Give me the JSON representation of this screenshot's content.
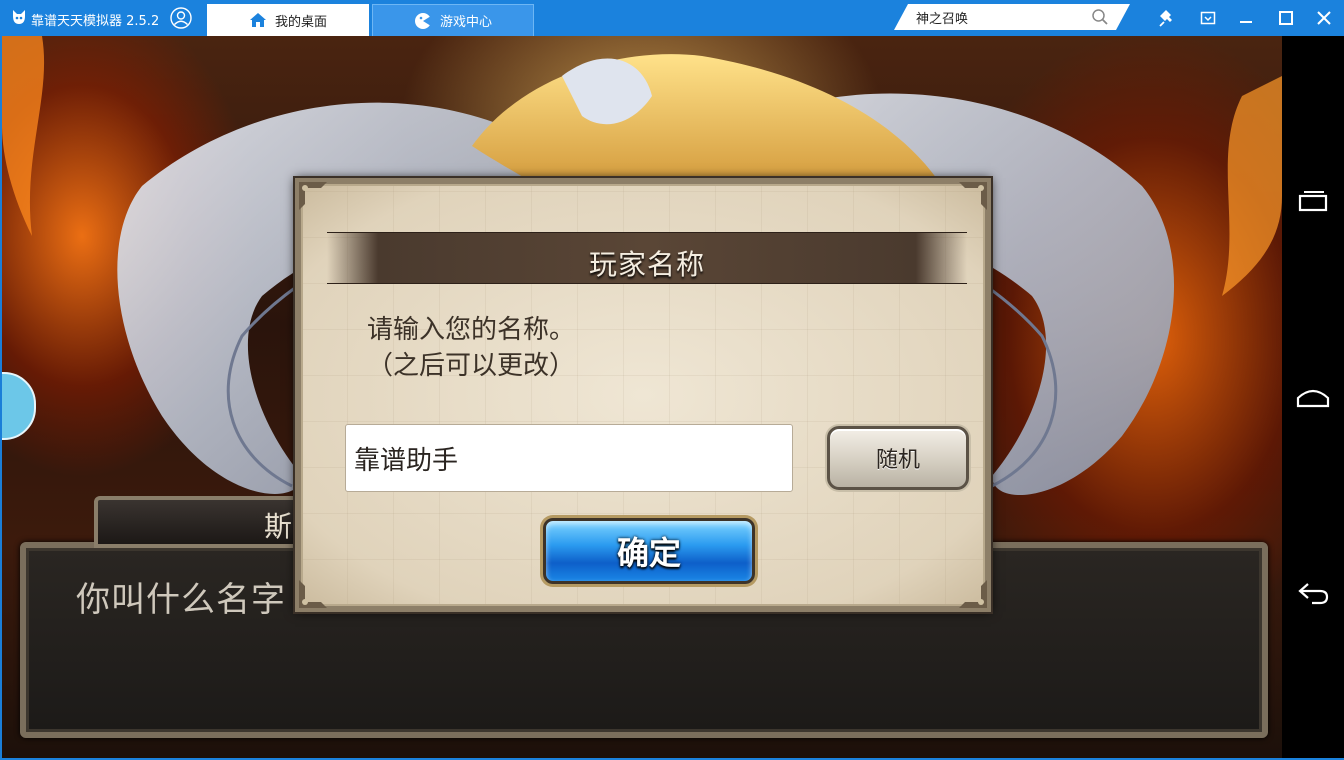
{
  "app": {
    "title": "靠谱天天模拟器 2.5.2"
  },
  "tabs": [
    {
      "label": "我的桌面",
      "icon": "home-icon",
      "active": true
    },
    {
      "label": "游戏中心",
      "icon": "gamepad-icon",
      "active": false
    }
  ],
  "search": {
    "value": "神之召唤"
  },
  "window_controls": [
    "pin-icon",
    "minimize-to-tray-icon",
    "minimize-icon",
    "maximize-icon",
    "close-icon"
  ],
  "android_nav": [
    "recent-apps-icon",
    "home-icon",
    "back-icon"
  ],
  "game": {
    "speaker_name": "斯",
    "speech_text": "你叫什么名字",
    "modal": {
      "title": "玩家名称",
      "prompt_line1": "请输入您的名称。",
      "prompt_line2": "（之后可以更改）",
      "name_value": "靠谱助手",
      "random_label": "随机",
      "confirm_label": "确定"
    }
  },
  "colors": {
    "titlebar": "#1b82dd",
    "confirm_button": "#1a86e6",
    "modal_background": "#e8dcc6"
  }
}
